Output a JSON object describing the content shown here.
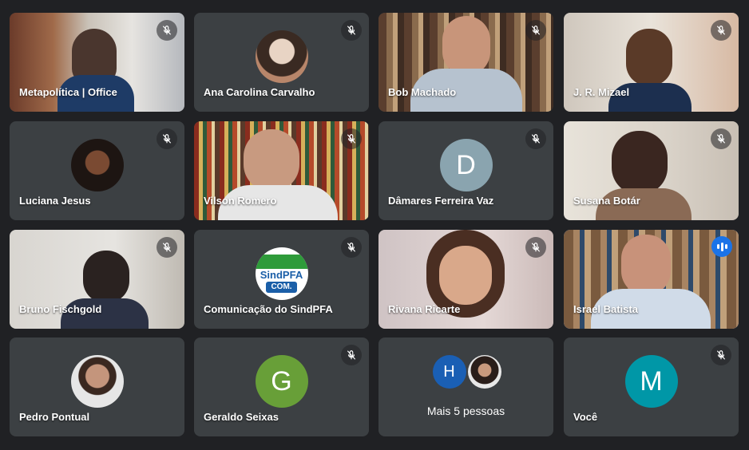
{
  "participants": [
    {
      "name": "Metapolítica | Office"
    },
    {
      "name": "Ana Carolina Carvalho"
    },
    {
      "name": "Bob Machado"
    },
    {
      "name": "J. R. Mizael"
    },
    {
      "name": "Luciana Jesus"
    },
    {
      "name": "Vilson Romero"
    },
    {
      "name": "Dâmares Ferreira Vaz",
      "initial": "D"
    },
    {
      "name": "Susana Botár"
    },
    {
      "name": "Bruno Fischgold"
    },
    {
      "name": "Comunicação do SindPFA",
      "logo_top": "SindPFA",
      "logo_bottom": "COM."
    },
    {
      "name": "Rivana Ricarte"
    },
    {
      "name": "Israel Batista"
    },
    {
      "name": "Pedro Pontual"
    },
    {
      "name": "Geraldo Seixas",
      "initial": "G"
    },
    {
      "more_label": "Mais 5 pessoas",
      "initial": "H"
    },
    {
      "name": "Você",
      "initial": "M"
    }
  ],
  "icons": {
    "mute": "mic-off-icon",
    "speaking": "audio-level-icon"
  },
  "colors": {
    "background": "#202124",
    "tile": "#3c4043",
    "active_border": "#8ab4f8",
    "D": "#8aa4af",
    "G": "#689f38",
    "H": "#1a5fb4",
    "M": "#0097a7"
  }
}
